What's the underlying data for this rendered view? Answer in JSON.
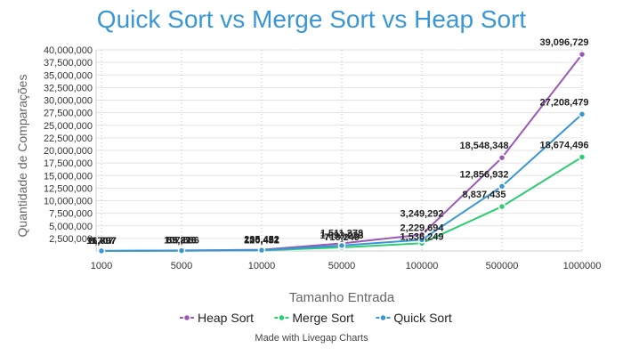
{
  "chart_data": {
    "type": "line",
    "title": "Quick Sort vs Merge Sort vs Heap Sort",
    "xlabel": "Tamanho Entrada",
    "ylabel": "Quantidade de Comparações",
    "categories": [
      "1000",
      "5000",
      "10000",
      "50000",
      "100000",
      "500000",
      "1000000"
    ],
    "series": [
      {
        "name": "Heap Sort",
        "color": "#9b59b6",
        "values": [
          16807,
          107566,
          235452,
          1511278,
          3249292,
          18548348,
          39096729
        ],
        "labels": [
          "16,807",
          "107,566",
          "235,452",
          "1,511,278",
          "3,249,292",
          "18,548,348",
          "39,096,729"
        ]
      },
      {
        "name": "Merge Sort",
        "color": "#2ecc71",
        "values": [
          8707,
          55216,
          120451,
          718249,
          1536249,
          8837435,
          18674496
        ],
        "labels": [
          "8,707",
          "55,216",
          "120,451",
          "718,249",
          "1,536,249",
          "8,837,435",
          "18,674,496"
        ]
      },
      {
        "name": "Quick Sort",
        "color": "#3a97d6",
        "values": [
          11797,
          69826,
          156422,
          1093233,
          2229694,
          12856932,
          27208479
        ],
        "labels": [
          "11,797",
          "69,826",
          "156,422",
          "1,093,233",
          "2,229,694",
          "12,856,932",
          "27,208,479"
        ]
      }
    ],
    "ylim": [
      0,
      40000000
    ],
    "yticks": [
      "2,500,000",
      "5,000,000",
      "7,500,000",
      "10,000,000",
      "12,500,000",
      "15,000,000",
      "17,500,000",
      "20,000,000",
      "22,500,000",
      "25,000,000",
      "27,500,000",
      "30,000,000",
      "32,500,000",
      "35,000,000",
      "37,500,000",
      "40,000,000"
    ],
    "grid": true,
    "legend": "bottom"
  },
  "footer": "Made with Livegap Charts"
}
